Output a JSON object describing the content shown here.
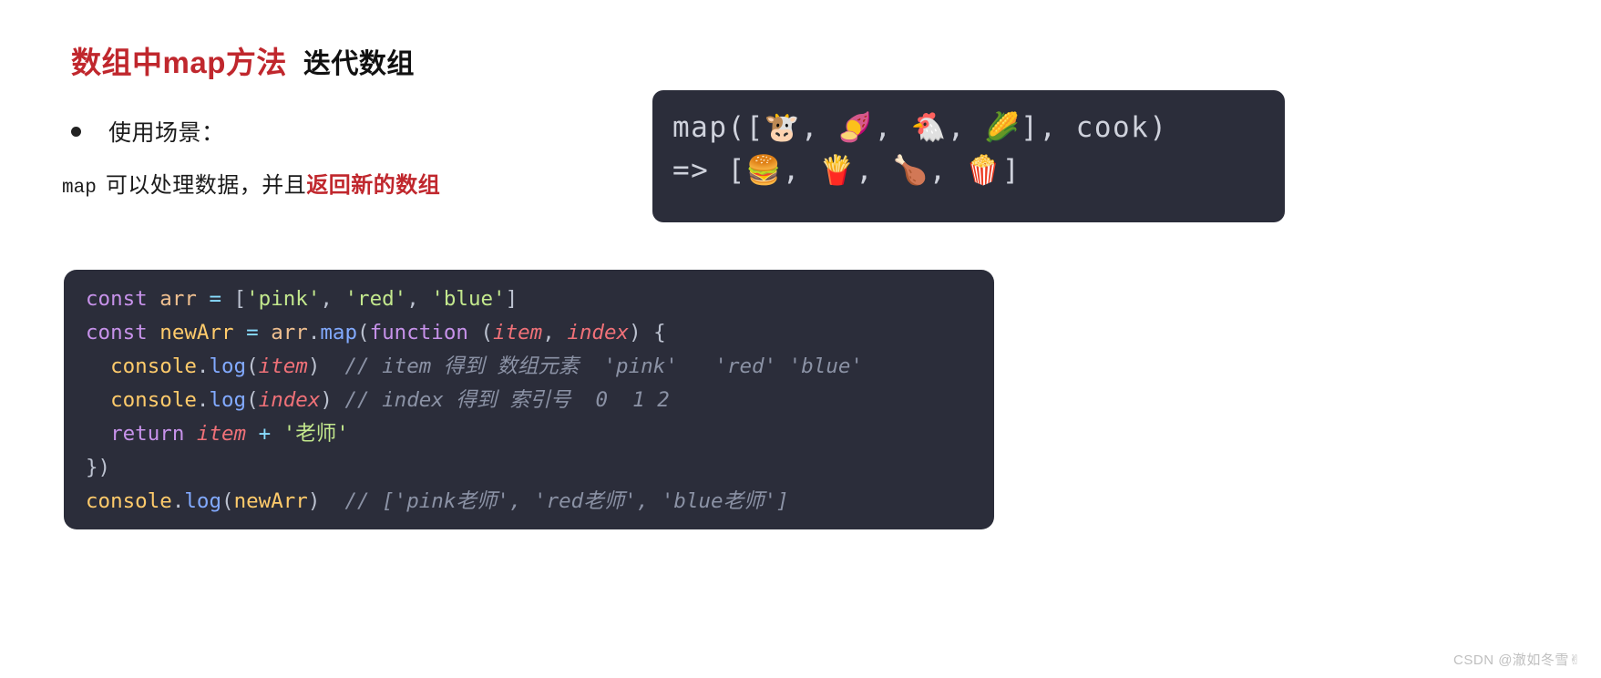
{
  "slide": {
    "title": {
      "highlight": "数组中map方法",
      "rest": "迭代数组"
    },
    "bullet": {
      "label": "使用场景："
    },
    "paragraph": {
      "code": "map",
      "plain": "可以处理数据，并且",
      "emphasis": "返回新的数组"
    },
    "emoji_panel": {
      "line1_pre": "map([",
      "line1_items": "🐮, 🍠, 🐔, 🌽",
      "line1_post": "], cook)",
      "line2_pre": "=> [",
      "line2_items": "🍔, 🍟, 🍗, 🍿",
      "line2_post": "]",
      "full_line1": "map([🐮, 🍠, 🐔, 🌽], cook)",
      "full_line2": "=> [🍔, 🍟, 🍗, 🍿]",
      "background": "#2b2d3a",
      "text_color": "#cfd2dc"
    },
    "code_panel": {
      "background": "#2b2d3a",
      "lines": [
        {
          "n": 1,
          "text": "const arr = ['pink', 'red', 'blue']",
          "tokens": [
            {
              "t": "const",
              "c": "t-kw"
            },
            {
              "t": " ",
              "c": "t-pun"
            },
            {
              "t": "arr",
              "c": "t-obj"
            },
            {
              "t": " ",
              "c": "t-pun"
            },
            {
              "t": "=",
              "c": "t-op"
            },
            {
              "t": " [",
              "c": "t-pun"
            },
            {
              "t": "'pink'",
              "c": "t-str"
            },
            {
              "t": ", ",
              "c": "t-pun"
            },
            {
              "t": "'red'",
              "c": "t-str"
            },
            {
              "t": ", ",
              "c": "t-pun"
            },
            {
              "t": "'blue'",
              "c": "t-str"
            },
            {
              "t": "]",
              "c": "t-pun"
            }
          ]
        },
        {
          "n": 2,
          "text": "const newArr = arr.map(function (item, index) {",
          "tokens": [
            {
              "t": "const",
              "c": "t-kw"
            },
            {
              "t": " ",
              "c": "t-pun"
            },
            {
              "t": "newArr",
              "c": "t-var"
            },
            {
              "t": " ",
              "c": "t-pun"
            },
            {
              "t": "=",
              "c": "t-op"
            },
            {
              "t": " ",
              "c": "t-pun"
            },
            {
              "t": "arr",
              "c": "t-obj"
            },
            {
              "t": ".",
              "c": "t-pun"
            },
            {
              "t": "map",
              "c": "t-fn"
            },
            {
              "t": "(",
              "c": "t-pun"
            },
            {
              "t": "function",
              "c": "t-kw"
            },
            {
              "t": " (",
              "c": "t-pun"
            },
            {
              "t": "item",
              "c": "t-par"
            },
            {
              "t": ", ",
              "c": "t-pun"
            },
            {
              "t": "index",
              "c": "t-par"
            },
            {
              "t": ") {",
              "c": "t-pun"
            }
          ]
        },
        {
          "n": 3,
          "text": "  console.log(item)  // item 得到 数组元素  'pink'   'red' 'blue'",
          "tokens": [
            {
              "t": "  ",
              "c": "t-pun"
            },
            {
              "t": "console",
              "c": "t-var"
            },
            {
              "t": ".",
              "c": "t-pun"
            },
            {
              "t": "log",
              "c": "t-fn"
            },
            {
              "t": "(",
              "c": "t-pun"
            },
            {
              "t": "item",
              "c": "t-par"
            },
            {
              "t": ")",
              "c": "t-pun"
            },
            {
              "t": "  // item 得到 数组元素  'pink'   'red' 'blue'",
              "c": "t-cmt"
            }
          ]
        },
        {
          "n": 4,
          "text": "  console.log(index) // index 得到 索引号  0  1 2",
          "tokens": [
            {
              "t": "  ",
              "c": "t-pun"
            },
            {
              "t": "console",
              "c": "t-var"
            },
            {
              "t": ".",
              "c": "t-pun"
            },
            {
              "t": "log",
              "c": "t-fn"
            },
            {
              "t": "(",
              "c": "t-pun"
            },
            {
              "t": "index",
              "c": "t-par"
            },
            {
              "t": ")",
              "c": "t-pun"
            },
            {
              "t": " // index 得到 索引号  0  1 2",
              "c": "t-cmt"
            }
          ]
        },
        {
          "n": 5,
          "text": "  return item + '老师'",
          "tokens": [
            {
              "t": "  ",
              "c": "t-pun"
            },
            {
              "t": "return",
              "c": "t-kw"
            },
            {
              "t": " ",
              "c": "t-pun"
            },
            {
              "t": "item",
              "c": "t-par"
            },
            {
              "t": " ",
              "c": "t-pun"
            },
            {
              "t": "+",
              "c": "t-op"
            },
            {
              "t": " ",
              "c": "t-pun"
            },
            {
              "t": "'老师'",
              "c": "t-str"
            }
          ]
        },
        {
          "n": 6,
          "text": "})",
          "tokens": [
            {
              "t": "})",
              "c": "t-pun"
            }
          ]
        },
        {
          "n": 7,
          "text": "console.log(newArr)  // ['pink老师', 'red老师', 'blue老师']",
          "tokens": [
            {
              "t": "console",
              "c": "t-var"
            },
            {
              "t": ".",
              "c": "t-pun"
            },
            {
              "t": "log",
              "c": "t-fn"
            },
            {
              "t": "(",
              "c": "t-pun"
            },
            {
              "t": "newArr",
              "c": "t-var"
            },
            {
              "t": ")",
              "c": "t-pun"
            },
            {
              "t": "  // ['pink老师', 'red老师', 'blue老师']",
              "c": "t-cmt"
            }
          ]
        }
      ]
    },
    "watermark": "CSDN @澈如冬雪✌"
  }
}
